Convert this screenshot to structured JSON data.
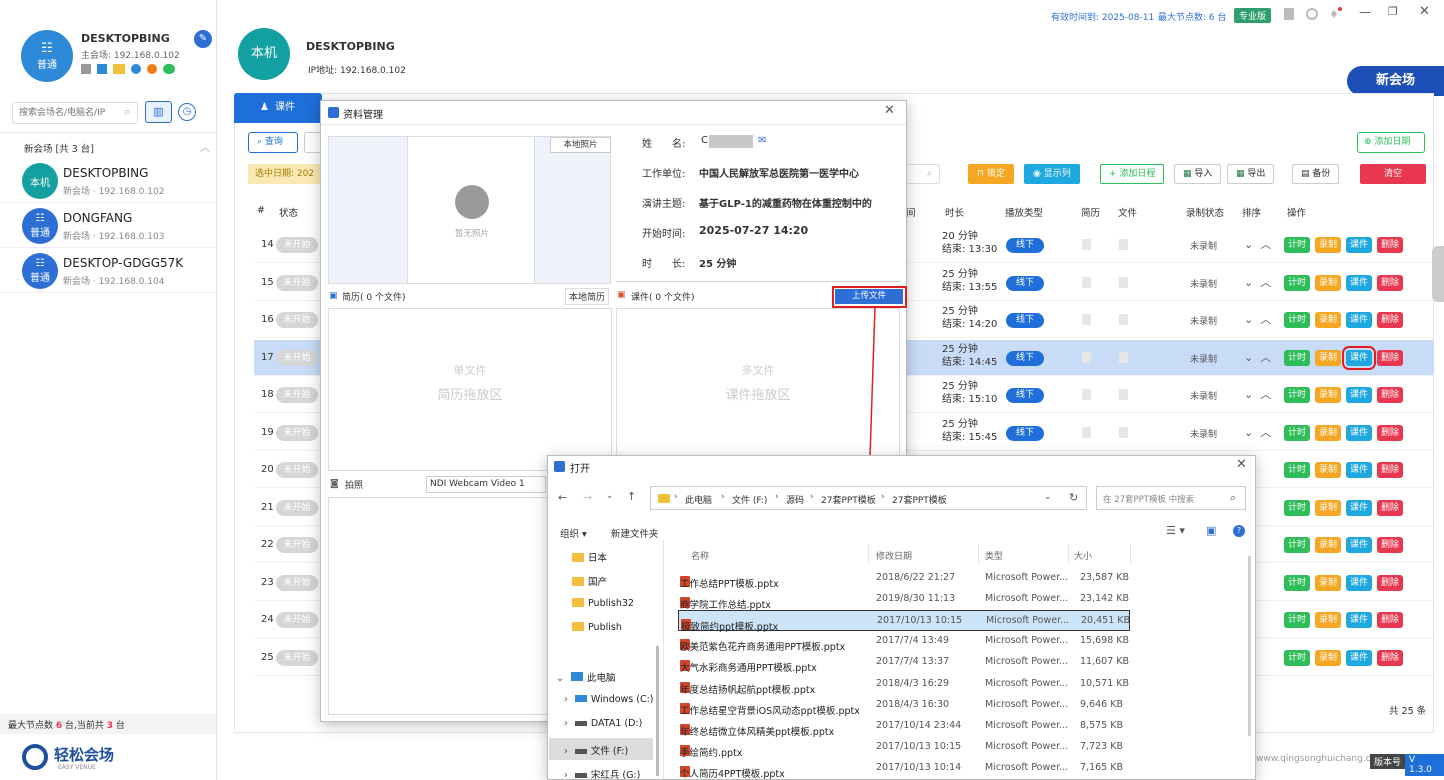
{
  "header": {
    "expire": "有效时间到: 2025-08-11",
    "max_nodes": "最大节点数: 6 台",
    "edition": "专业版",
    "new_venue": "新会场"
  },
  "sidebar": {
    "host_name": "DESKTOPBING",
    "host_ip": "主会场: 192.168.0.102",
    "host_badge": "普通",
    "search_placeholder": "搜索会场名/电脑名/IP",
    "group_title": "新会场 [共 3 台]",
    "devices": [
      {
        "avatar": "本机",
        "name": "DESKTOPBING",
        "ip": "新会场 · 192.168.0.102",
        "color": "#12a0a0"
      },
      {
        "avatar": "普通",
        "name": "DONGFANG",
        "ip": "新会场 · 192.168.0.103",
        "color": "#2d6fd4"
      },
      {
        "avatar": "普通",
        "name": "DESKTOP-GDGG57K",
        "ip": "新会场 · 192.168.0.104",
        "color": "#2d6fd4"
      }
    ],
    "footer_prefix": "最大节点数",
    "footer_max": "6",
    "footer_mid": "台,当前共",
    "footer_count": "3",
    "footer_suffix": "台",
    "brand": "轻松会场",
    "brand_sub": "EASY VENUE"
  },
  "machine": {
    "avatar": "本机",
    "name": "DESKTOPBING",
    "ip": "IP地址: 192.168.0.102"
  },
  "toolbar": {
    "tab_course": "课件",
    "query": "查询",
    "selected_date": "选中日期: 202",
    "add_date": "添加日期",
    "lock": "锁定",
    "show_cols": "显示列",
    "add_schedule": "添加日程",
    "import": "导入",
    "export": "导出",
    "backup": "备份",
    "clear": "清空"
  },
  "table": {
    "headers": [
      "#",
      "状态",
      "间",
      "时长",
      "播放类型",
      "简历",
      "文件",
      "录制状态",
      "排序",
      "操作"
    ],
    "rows": [
      {
        "num": "14",
        "status": "未开始",
        "dur": "20 分钟",
        "end": "结束: 13:30",
        "play": "线下",
        "rec": "未录制"
      },
      {
        "num": "15",
        "status": "未开始",
        "dur": "25 分钟",
        "end": "结束: 13:55",
        "play": "线下",
        "rec": "未录制"
      },
      {
        "num": "16",
        "status": "未开始",
        "dur": "25 分钟",
        "end": "结束: 14:20",
        "play": "线下",
        "rec": "未录制"
      },
      {
        "num": "17",
        "status": "未开始",
        "dur": "25 分钟",
        "end": "结束: 14:45",
        "play": "线下",
        "rec": "未录制"
      },
      {
        "num": "18",
        "status": "未开始",
        "dur": "25 分钟",
        "end": "结束: 15:10",
        "play": "线下",
        "rec": "未录制"
      },
      {
        "num": "19",
        "status": "未开始",
        "dur": "25 分钟",
        "end": "结束: 15:45",
        "play": "线下",
        "rec": "未录制"
      },
      {
        "num": "20",
        "status": "未开始",
        "dur": "",
        "end": "",
        "play": "",
        "rec": ""
      },
      {
        "num": "21",
        "status": "未开始",
        "dur": "",
        "end": "",
        "play": "",
        "rec": ""
      },
      {
        "num": "22",
        "status": "未开始",
        "dur": "",
        "end": "",
        "play": "",
        "rec": ""
      },
      {
        "num": "23",
        "status": "未开始",
        "dur": "",
        "end": "",
        "play": "",
        "rec": ""
      },
      {
        "num": "24",
        "status": "未开始",
        "dur": "",
        "end": "",
        "play": "",
        "rec": ""
      },
      {
        "num": "25",
        "status": "未开始",
        "dur": "",
        "end": "",
        "play": "",
        "rec": ""
      }
    ],
    "ops": [
      "计时",
      "录制",
      "课件",
      "删除"
    ],
    "total": "共 25 条"
  },
  "material": {
    "title": "资料管理",
    "local_photo": "本地照片",
    "no_photo": "暂无照片",
    "name_label": "姓　　名:",
    "name_value": "C",
    "unit_label": "工作单位:",
    "unit_value": "中国人民解放军总医院第一医学中心",
    "topic_label": "演讲主题:",
    "topic_value": "基于GLP-1的减重药物在体重控制中的",
    "start_label": "开始时间:",
    "start_value": "2025-07-27 14:20",
    "dur_label": "时　　长:",
    "dur_value": "25 分钟",
    "resume_header": "简历( 0 个文件)",
    "local_resume": "本地简历",
    "course_header": "课件( 0 个文件)",
    "upload": "上传文件",
    "single_file": "单文件",
    "resume_drop": "简历拖放区",
    "multi_file": "多文件",
    "course_drop": "课件拖放区",
    "photo_label": "拍照",
    "camera": "NDI Webcam Video 1"
  },
  "open_dialog": {
    "title": "打开",
    "path": [
      "此电脑",
      "文件 (F:)",
      "源码",
      "27套PPT模板",
      "27套PPT模板"
    ],
    "search_placeholder": "在 27套PPT模板 中搜索",
    "organize": "组织 ▾",
    "new_folder": "新建文件夹",
    "tree": [
      "日本",
      "国产",
      "Publish32",
      "Publish",
      "此电脑",
      "Windows (C:)",
      "DATA1 (D:)",
      "文件 (F:)",
      "宋红兵 (G:)"
    ],
    "col_name": "名称",
    "col_date": "修改日期",
    "col_type": "类型",
    "col_size": "大小",
    "files": [
      {
        "name": "工作总结PPT模板.pptx",
        "date": "2018/6/22 21:27",
        "type": "Microsoft Power...",
        "size": "23,587 KB"
      },
      {
        "name": "商学院工作总结.pptx",
        "date": "2019/8/30 11:13",
        "type": "Microsoft Power...",
        "size": "23,142 KB"
      },
      {
        "name": "极致简约ppt模板.pptx",
        "date": "2017/10/13 10:15",
        "type": "Microsoft Power...",
        "size": "20,451 KB"
      },
      {
        "name": "欧美范紫色花卉商务通用PPT模板.pptx",
        "date": "2017/7/4 13:49",
        "type": "Microsoft Power...",
        "size": "15,698 KB"
      },
      {
        "name": "大气水彩商务通用PPT模板.pptx",
        "date": "2017/7/4 13:37",
        "type": "Microsoft Power...",
        "size": "11,607 KB"
      },
      {
        "name": "年度总结扬帆起航ppt模板.pptx",
        "date": "2018/4/3 16:29",
        "type": "Microsoft Power...",
        "size": "10,571 KB"
      },
      {
        "name": "工作总结星空背景iOS风动态ppt模板.pptx",
        "date": "2018/4/3 16:30",
        "type": "Microsoft Power...",
        "size": "9,646 KB"
      },
      {
        "name": "年终总结微立体风精美ppt模板.pptx",
        "date": "2017/10/14 23:44",
        "type": "Microsoft Power...",
        "size": "8,575 KB"
      },
      {
        "name": "手绘简约.pptx",
        "date": "2017/10/13 10:15",
        "type": "Microsoft Power...",
        "size": "7,723 KB"
      },
      {
        "name": "个人简历4PPT模板.pptx",
        "date": "2017/10/13 10:14",
        "type": "Microsoft Power...",
        "size": "7,165 KB"
      }
    ]
  },
  "footer": {
    "website": "www.qingsonghuichang.com",
    "version_label": "版本号",
    "version": "V 1.3.0"
  },
  "colors": {
    "accent": "#1e6fd9",
    "green": "#2ebd59",
    "orange": "#f5a623",
    "cyan": "#1fa8e0",
    "red": "#e8384f",
    "highlight": "#c8dcf7"
  }
}
